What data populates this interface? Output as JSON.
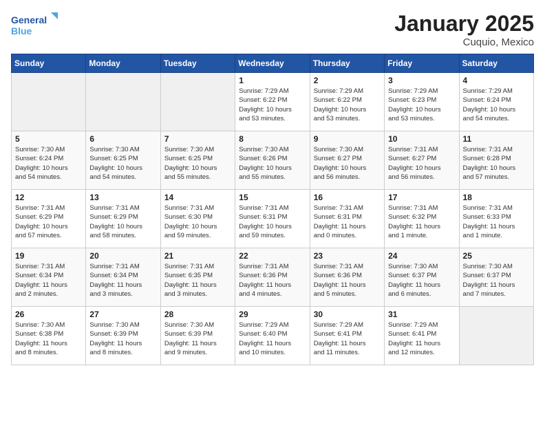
{
  "header": {
    "logo_line1": "General",
    "logo_line2": "Blue",
    "title": "January 2025",
    "subtitle": "Cuquio, Mexico"
  },
  "days_of_week": [
    "Sunday",
    "Monday",
    "Tuesday",
    "Wednesday",
    "Thursday",
    "Friday",
    "Saturday"
  ],
  "weeks": [
    [
      {
        "num": "",
        "info": ""
      },
      {
        "num": "",
        "info": ""
      },
      {
        "num": "",
        "info": ""
      },
      {
        "num": "1",
        "info": "Sunrise: 7:29 AM\nSunset: 6:22 PM\nDaylight: 10 hours\nand 53 minutes."
      },
      {
        "num": "2",
        "info": "Sunrise: 7:29 AM\nSunset: 6:22 PM\nDaylight: 10 hours\nand 53 minutes."
      },
      {
        "num": "3",
        "info": "Sunrise: 7:29 AM\nSunset: 6:23 PM\nDaylight: 10 hours\nand 53 minutes."
      },
      {
        "num": "4",
        "info": "Sunrise: 7:29 AM\nSunset: 6:24 PM\nDaylight: 10 hours\nand 54 minutes."
      }
    ],
    [
      {
        "num": "5",
        "info": "Sunrise: 7:30 AM\nSunset: 6:24 PM\nDaylight: 10 hours\nand 54 minutes."
      },
      {
        "num": "6",
        "info": "Sunrise: 7:30 AM\nSunset: 6:25 PM\nDaylight: 10 hours\nand 54 minutes."
      },
      {
        "num": "7",
        "info": "Sunrise: 7:30 AM\nSunset: 6:25 PM\nDaylight: 10 hours\nand 55 minutes."
      },
      {
        "num": "8",
        "info": "Sunrise: 7:30 AM\nSunset: 6:26 PM\nDaylight: 10 hours\nand 55 minutes."
      },
      {
        "num": "9",
        "info": "Sunrise: 7:30 AM\nSunset: 6:27 PM\nDaylight: 10 hours\nand 56 minutes."
      },
      {
        "num": "10",
        "info": "Sunrise: 7:31 AM\nSunset: 6:27 PM\nDaylight: 10 hours\nand 56 minutes."
      },
      {
        "num": "11",
        "info": "Sunrise: 7:31 AM\nSunset: 6:28 PM\nDaylight: 10 hours\nand 57 minutes."
      }
    ],
    [
      {
        "num": "12",
        "info": "Sunrise: 7:31 AM\nSunset: 6:29 PM\nDaylight: 10 hours\nand 57 minutes."
      },
      {
        "num": "13",
        "info": "Sunrise: 7:31 AM\nSunset: 6:29 PM\nDaylight: 10 hours\nand 58 minutes."
      },
      {
        "num": "14",
        "info": "Sunrise: 7:31 AM\nSunset: 6:30 PM\nDaylight: 10 hours\nand 59 minutes."
      },
      {
        "num": "15",
        "info": "Sunrise: 7:31 AM\nSunset: 6:31 PM\nDaylight: 10 hours\nand 59 minutes."
      },
      {
        "num": "16",
        "info": "Sunrise: 7:31 AM\nSunset: 6:31 PM\nDaylight: 11 hours\nand 0 minutes."
      },
      {
        "num": "17",
        "info": "Sunrise: 7:31 AM\nSunset: 6:32 PM\nDaylight: 11 hours\nand 1 minute."
      },
      {
        "num": "18",
        "info": "Sunrise: 7:31 AM\nSunset: 6:33 PM\nDaylight: 11 hours\nand 1 minute."
      }
    ],
    [
      {
        "num": "19",
        "info": "Sunrise: 7:31 AM\nSunset: 6:34 PM\nDaylight: 11 hours\nand 2 minutes."
      },
      {
        "num": "20",
        "info": "Sunrise: 7:31 AM\nSunset: 6:34 PM\nDaylight: 11 hours\nand 3 minutes."
      },
      {
        "num": "21",
        "info": "Sunrise: 7:31 AM\nSunset: 6:35 PM\nDaylight: 11 hours\nand 3 minutes."
      },
      {
        "num": "22",
        "info": "Sunrise: 7:31 AM\nSunset: 6:36 PM\nDaylight: 11 hours\nand 4 minutes."
      },
      {
        "num": "23",
        "info": "Sunrise: 7:31 AM\nSunset: 6:36 PM\nDaylight: 11 hours\nand 5 minutes."
      },
      {
        "num": "24",
        "info": "Sunrise: 7:30 AM\nSunset: 6:37 PM\nDaylight: 11 hours\nand 6 minutes."
      },
      {
        "num": "25",
        "info": "Sunrise: 7:30 AM\nSunset: 6:37 PM\nDaylight: 11 hours\nand 7 minutes."
      }
    ],
    [
      {
        "num": "26",
        "info": "Sunrise: 7:30 AM\nSunset: 6:38 PM\nDaylight: 11 hours\nand 8 minutes."
      },
      {
        "num": "27",
        "info": "Sunrise: 7:30 AM\nSunset: 6:39 PM\nDaylight: 11 hours\nand 8 minutes."
      },
      {
        "num": "28",
        "info": "Sunrise: 7:30 AM\nSunset: 6:39 PM\nDaylight: 11 hours\nand 9 minutes."
      },
      {
        "num": "29",
        "info": "Sunrise: 7:29 AM\nSunset: 6:40 PM\nDaylight: 11 hours\nand 10 minutes."
      },
      {
        "num": "30",
        "info": "Sunrise: 7:29 AM\nSunset: 6:41 PM\nDaylight: 11 hours\nand 11 minutes."
      },
      {
        "num": "31",
        "info": "Sunrise: 7:29 AM\nSunset: 6:41 PM\nDaylight: 11 hours\nand 12 minutes."
      },
      {
        "num": "",
        "info": ""
      }
    ]
  ]
}
